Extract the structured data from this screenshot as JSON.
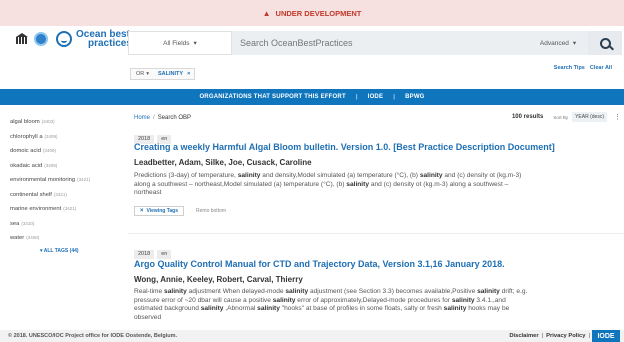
{
  "banner": {
    "text": "UNDER DEVELOPMENT",
    "icon": "warning-icon"
  },
  "logo": {
    "line1": "Ocean best",
    "line2": "practices"
  },
  "search": {
    "field_label": "All Fields",
    "placeholder": "Search OceanBestPractices",
    "advanced_label": "Advanced",
    "tips": "Search Tips",
    "clear": "Clear All"
  },
  "filter": {
    "operator": "OR",
    "value": "SALINITY"
  },
  "nav": {
    "items": [
      "ORGANIZATIONS THAT SUPPORT THIS EFFORT",
      "IODE",
      "BPWG"
    ]
  },
  "sidebar": {
    "items": [
      {
        "label": "algal bloom",
        "count": "(3403)"
      },
      {
        "label": "chlorophyll a",
        "count": "(3409)"
      },
      {
        "label": "domoic acid",
        "count": "(3409)"
      },
      {
        "label": "okadaic acid",
        "count": "(3409)"
      },
      {
        "label": "environmental monitoring",
        "count": "(3421)"
      },
      {
        "label": "continental shelf",
        "count": "(3421)"
      },
      {
        "label": "marine environment",
        "count": "(3421)"
      },
      {
        "label": "sea",
        "count": "(3410)"
      },
      {
        "label": "water",
        "count": "(3408)"
      }
    ],
    "all_tags": "ALL TAGS (44)"
  },
  "breadcrumb": {
    "home": "Home",
    "current": "Search OBP"
  },
  "results": {
    "count": "100 results",
    "sort_label": "Sort By",
    "sort_value": "YEAR (desc)"
  },
  "records": [
    {
      "year": "2018",
      "lang": "en",
      "title": "Creating a weekly Harmful Algal Bloom bulletin. Version 1.0. [Best Practice Description Document]",
      "authors": "Leadbetter, Adam, Silke, Joe, Cusack, Caroline",
      "abstract_line1_a": "Predictions (3-day) of temperature, ",
      "abstract_line1_b": "salinity",
      "abstract_line1_c": " and density,Model simulated (a) temperature (°C), (b) ",
      "abstract_line1_d": "salinity",
      "abstract_line1_e": " and (c) density ot (kg.m-3)",
      "abstract_line2_a": "along a southwest – northeast,Model simulated (a) temperature (°C), (b) ",
      "abstract_line2_b": "salinity",
      "abstract_line2_c": " and (c) density ot (kg.m-3) along a southwest –",
      "abstract_line3": "northeast",
      "view_tags": "Viewing Tags",
      "after_tags": "Remo bottom"
    },
    {
      "year": "2018",
      "lang": "en",
      "title": "Argo Quality Control Manual for CTD and Trajectory Data, Version 3.1,16 January 2018.",
      "authors": "Wong, Annie, Keeley, Robert, Carval, Thierry",
      "abstract_line1_a": "Real-time ",
      "abstract_line1_b": "salinity",
      "abstract_line1_c": " adjustment When delayed-mode ",
      "abstract_line1_d": "salinity",
      "abstract_line1_e": " adjustment (see Section 3.3) becomes available,Positive ",
      "abstract_line1_f": "salinity",
      "abstract_line1_g": " drift; e.g.",
      "abstract_line2_a": "pressure error of ~20 dbar will cause a positive ",
      "abstract_line2_b": "salinity",
      "abstract_line2_c": " error of approximately,Delayed-mode procedures for ",
      "abstract_line2_d": "salinity",
      "abstract_line2_e": " 3.4.1.,and",
      "abstract_line3_a": "estimated background ",
      "abstract_line3_b": "salinity",
      "abstract_line3_c": " ,Abnormal ",
      "abstract_line3_d": "salinity",
      "abstract_line3_e": " \"hooks\" at base of profiles in some floats, salty or fresh ",
      "abstract_line3_f": "salinity",
      "abstract_line3_g": " hooks may be",
      "abstract_line4": "observed"
    }
  ],
  "footer": {
    "copyright": "© 2018. UNESCO/IOC Project office for IODE Oostende, Belgium.",
    "links": [
      "Disclaimer",
      "Privacy Policy"
    ],
    "badge": "IODE"
  },
  "colors": {
    "brand_blue": "#0f75bd",
    "banner_bg": "#f6e0e0",
    "banner_text": "#c0392b",
    "link": "#1f6fb4"
  }
}
